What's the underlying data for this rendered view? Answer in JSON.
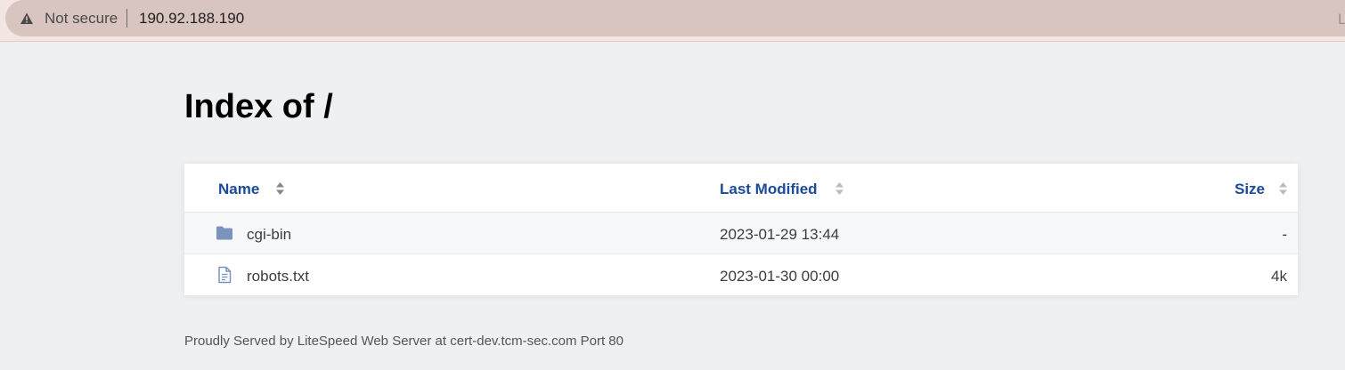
{
  "browser": {
    "security_label": "Not secure",
    "url": "190.92.188.190",
    "edge_fragment": "L"
  },
  "page": {
    "title": "Index of /",
    "columns": {
      "name": "Name",
      "modified": "Last Modified",
      "size": "Size"
    },
    "entries": [
      {
        "name": "cgi-bin",
        "modified": "2023-01-29 13:44",
        "size": "-",
        "icon": "folder-icon"
      },
      {
        "name": "robots.txt",
        "modified": "2023-01-30 00:00",
        "size": "4k",
        "icon": "file-text-icon"
      }
    ],
    "footer": "Proudly Served by LiteSpeed Web Server at cert-dev.tcm-sec.com Port 80"
  },
  "colors": {
    "link_blue": "#1a4a9a",
    "folder_blue": "#7b93bd",
    "background": "#eef0f2"
  }
}
